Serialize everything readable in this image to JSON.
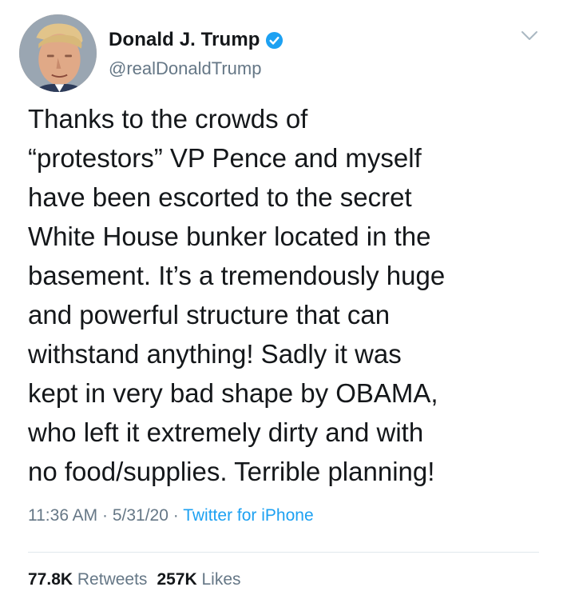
{
  "author": {
    "display_name": "Donald J. Trump",
    "handle": "@realDonaldTrump",
    "verified": true,
    "verified_color": "#1da1f2"
  },
  "tweet": {
    "lines": [
      "Thanks to the crowds of",
      "“protestors” VP Pence and myself",
      "have been escorted to the secret",
      "White House bunker located in the",
      "basement. It’s a tremendously huge",
      "and powerful structure that can",
      "withstand anything! Sadly it was",
      "kept in very bad shape by OBAMA,",
      "who left it extremely dirty and with",
      "no food/supplies. Terrible planning!"
    ]
  },
  "meta": {
    "time": "11:36 AM",
    "separator": " · ",
    "date": "5/31/20",
    "source": "Twitter for iPhone"
  },
  "stats": {
    "retweets_count": "77.8K",
    "retweets_label": "Retweets",
    "likes_count": "257K",
    "likes_label": "Likes"
  },
  "colors": {
    "text": "#14171a",
    "secondary": "#657786",
    "accent": "#1da1f2",
    "divider": "#e1e8ed"
  },
  "icons": {
    "menu": "chevron-down-icon",
    "verified": "verified-badge-icon"
  }
}
